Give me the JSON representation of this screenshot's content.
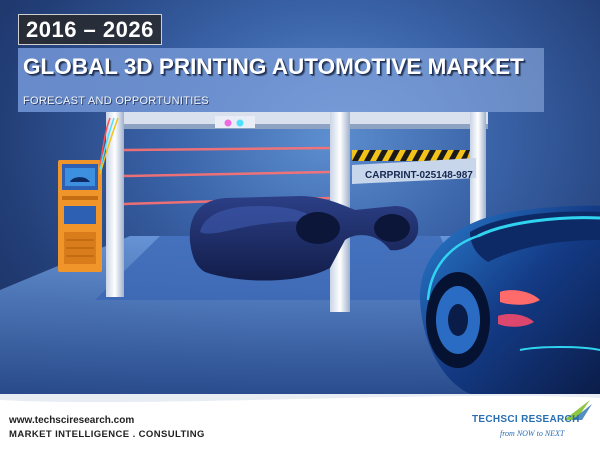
{
  "cover": {
    "year_range": "2016 – 2026",
    "title": "GLOBAL 3D PRINTING AUTOMOTIVE MARKET",
    "subtitle": "FORECAST AND OPPORTUNITIES",
    "license_plate": "CARPRINT-025148-987"
  },
  "footer": {
    "website": "www.techsciresearch.com",
    "tagline": "MARKET INTELLIGENCE . CONSULTING",
    "logo_name": "TECHSCI RESEARCH",
    "logo_tagline": "from NOW to NEXT"
  },
  "colors": {
    "background_blue": "#2b4d8c",
    "title_band": "#7d9fd9",
    "car_cyan": "#31d4f0",
    "laser_red": "#ff6a6a",
    "kiosk_orange": "#f09a2a",
    "logo_blue": "#2a6fb3",
    "logo_green": "#8dc63f"
  }
}
